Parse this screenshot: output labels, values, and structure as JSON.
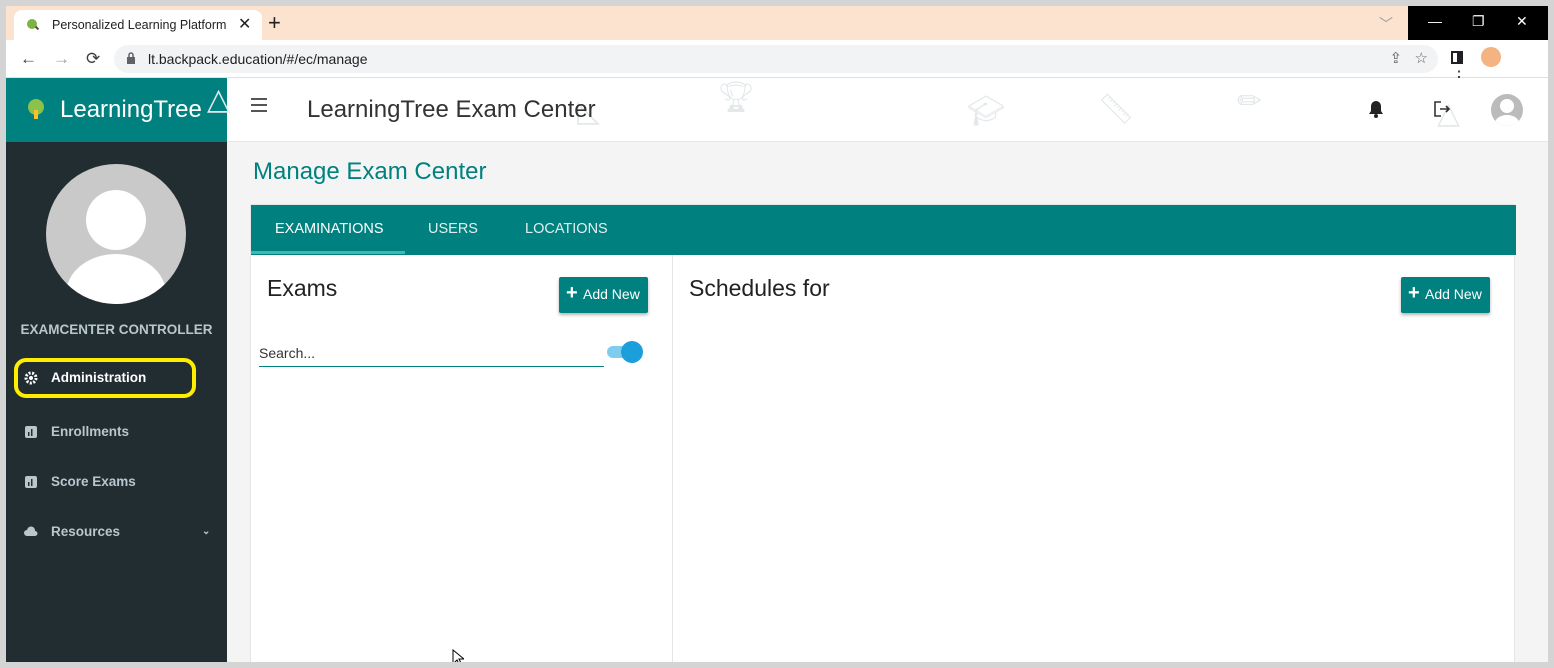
{
  "browser": {
    "tab_title": "Personalized Learning Platform |",
    "tab_close": "✕",
    "new_tab": "+",
    "url": "lt.backpack.education/#/ec/manage",
    "window_controls": {
      "minimize": "—",
      "restore": "❐",
      "close": "✕"
    }
  },
  "app": {
    "brand": "LearningTree",
    "header_title": "LearningTree Exam Center"
  },
  "sidebar": {
    "role": "EXAMCENTER CONTROLLER",
    "items": [
      {
        "label": "Administration",
        "icon": "gear-icon",
        "active": true
      },
      {
        "label": "Enrollments",
        "icon": "chart-icon"
      },
      {
        "label": "Score Exams",
        "icon": "chart-icon"
      },
      {
        "label": "Resources",
        "icon": "cloud-icon",
        "expandable": true
      }
    ]
  },
  "main": {
    "page_title": "Manage Exam Center",
    "tabs": [
      {
        "label": "EXAMINATIONS",
        "active": true
      },
      {
        "label": "USERS"
      },
      {
        "label": "LOCATIONS"
      }
    ],
    "exams": {
      "title": "Exams",
      "add_label": "Add New",
      "search_placeholder": "Search...",
      "toggle_on": true
    },
    "schedules": {
      "title": "Schedules for",
      "add_label": "Add New"
    }
  },
  "colors": {
    "brand": "#00817f",
    "sidebar": "#222d32",
    "highlight": "#ffee00",
    "toggle": "#1a9fdb"
  }
}
